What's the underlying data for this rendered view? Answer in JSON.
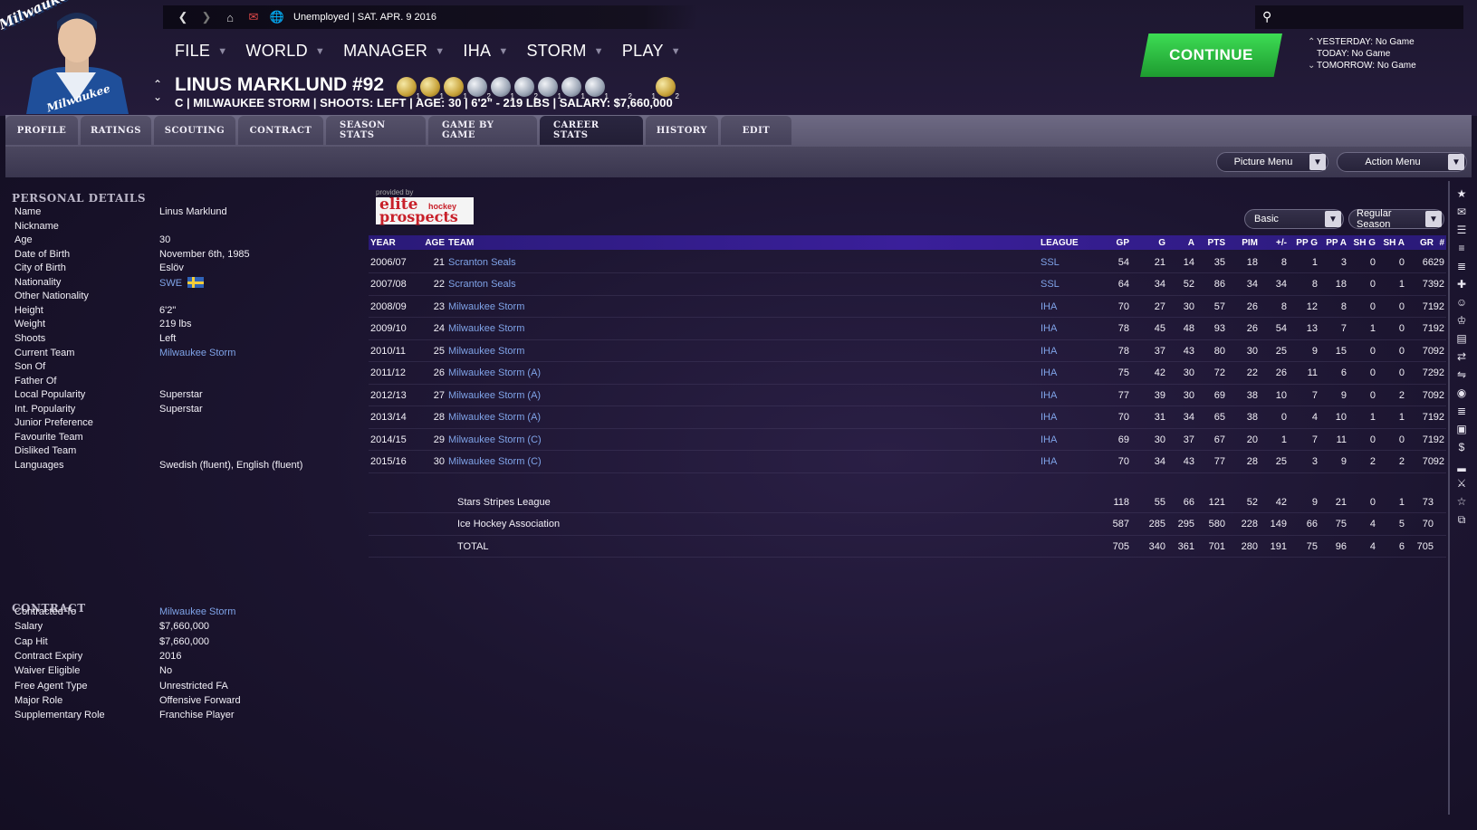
{
  "team_logo_text": "Milwaukee",
  "status": {
    "text": "Unemployed | SAT. APR. 9 2016"
  },
  "menu": [
    "FILE",
    "WORLD",
    "MANAGER",
    "IHA",
    "STORM",
    "PLAY"
  ],
  "player": {
    "name": "LINUS MARKLUND #92",
    "subline": "C | MILWAUKEE STORM | SHOOTS: LEFT | AGE: 30 | 6'2\" - 219 LBS | SALARY: $7,660,000",
    "awards": [
      {
        "kind": "gold",
        "n": "1"
      },
      {
        "kind": "gold",
        "n": "1"
      },
      {
        "kind": "gold",
        "n": "1"
      },
      {
        "kind": "silver",
        "n": "2"
      },
      {
        "kind": "silver",
        "n": "1"
      },
      {
        "kind": "silver",
        "n": "2"
      },
      {
        "kind": "silver",
        "n": "1"
      },
      {
        "kind": "silver",
        "n": "1"
      },
      {
        "kind": "silver",
        "n": "1"
      },
      {
        "kind": "blank",
        "n": "2"
      },
      {
        "kind": "blank",
        "n": "1"
      },
      {
        "kind": "gold",
        "n": "2"
      }
    ]
  },
  "continue_label": "CONTINUE",
  "schedule": {
    "yesterday": "YESTERDAY: No Game",
    "today": "TODAY: No Game",
    "tomorrow": "TOMORROW: No Game"
  },
  "tabs": [
    {
      "label": "PROFILE",
      "active": false
    },
    {
      "label": "RATINGS",
      "active": false
    },
    {
      "label": "SCOUTING",
      "active": false
    },
    {
      "label": "CONTRACT",
      "active": false
    },
    {
      "label": "SEASON STATS",
      "active": false
    },
    {
      "label": "GAME BY GAME",
      "active": false
    },
    {
      "label": "CAREER STATS",
      "active": true
    },
    {
      "label": "HISTORY",
      "active": false
    },
    {
      "label": "EDIT",
      "active": false
    }
  ],
  "picture_menu_label": "Picture Menu",
  "action_menu_label": "Action Menu",
  "personal_details": {
    "title": "PERSONAL DETAILS",
    "rows": [
      {
        "label": "Name",
        "value": "Linus Marklund"
      },
      {
        "label": "Nickname",
        "value": ""
      },
      {
        "label": "Age",
        "value": "30"
      },
      {
        "label": "Date of Birth",
        "value": "November 6th, 1985"
      },
      {
        "label": "City of Birth",
        "value": "Eslöv"
      },
      {
        "label": "Nationality",
        "value": "SWE",
        "link": true,
        "flag": true
      },
      {
        "label": "Other Nationality",
        "value": ""
      },
      {
        "label": "Height",
        "value": "6'2\""
      },
      {
        "label": "Weight",
        "value": "219 lbs"
      },
      {
        "label": "Shoots",
        "value": "Left"
      },
      {
        "label": "Current Team",
        "value": "Milwaukee Storm",
        "link": true
      },
      {
        "label": "Son Of",
        "value": ""
      },
      {
        "label": "Father Of",
        "value": ""
      },
      {
        "label": "Local Popularity",
        "value": "Superstar"
      },
      {
        "label": "Int. Popularity",
        "value": "Superstar"
      },
      {
        "label": "Junior Preference",
        "value": ""
      },
      {
        "label": "Favourite Team",
        "value": ""
      },
      {
        "label": "Disliked Team",
        "value": ""
      },
      {
        "label": "Languages",
        "value": "Swedish (fluent), English (fluent)"
      }
    ]
  },
  "contract": {
    "title": "CONTRACT",
    "rows": [
      {
        "label": "Contracted To",
        "value": "Milwaukee Storm",
        "link": true
      },
      {
        "label": "Salary",
        "value": "$7,660,000"
      },
      {
        "label": "Cap Hit",
        "value": "$7,660,000"
      },
      {
        "label": "Contract Expiry",
        "value": "2016"
      },
      {
        "label": "Waiver Eligible",
        "value": "No"
      },
      {
        "label": "Free Agent Type",
        "value": "Unrestricted FA"
      },
      {
        "label": "Major Role",
        "value": "Offensive Forward"
      },
      {
        "label": "Supplementary Role",
        "value": "Franchise Player"
      }
    ]
  },
  "elite": {
    "provided": "provided by",
    "line1": "elite",
    "small": "hockey",
    "line2": "prospects"
  },
  "filters": {
    "view": "Basic",
    "season": "Regular Season"
  },
  "table": {
    "headers": [
      "YEAR",
      "AGE",
      "TEAM",
      "LEAGUE",
      "GP",
      "G",
      "A",
      "PTS",
      "PIM",
      "+/-",
      "PP G",
      "PP A",
      "SH G",
      "SH A",
      "GR",
      "#"
    ],
    "rows": [
      [
        "2006/07",
        "21",
        "Scranton Seals",
        "SSL",
        "54",
        "21",
        "14",
        "35",
        "18",
        "8",
        "1",
        "3",
        "0",
        "0",
        "66",
        "29"
      ],
      [
        "2007/08",
        "22",
        "Scranton Seals",
        "SSL",
        "64",
        "34",
        "52",
        "86",
        "34",
        "34",
        "8",
        "18",
        "0",
        "1",
        "73",
        "92"
      ],
      [
        "2008/09",
        "23",
        "Milwaukee Storm",
        "IHA",
        "70",
        "27",
        "30",
        "57",
        "26",
        "8",
        "12",
        "8",
        "0",
        "0",
        "71",
        "92"
      ],
      [
        "2009/10",
        "24",
        "Milwaukee Storm",
        "IHA",
        "78",
        "45",
        "48",
        "93",
        "26",
        "54",
        "13",
        "7",
        "1",
        "0",
        "71",
        "92"
      ],
      [
        "2010/11",
        "25",
        "Milwaukee Storm",
        "IHA",
        "78",
        "37",
        "43",
        "80",
        "30",
        "25",
        "9",
        "15",
        "0",
        "0",
        "70",
        "92"
      ],
      [
        "2011/12",
        "26",
        "Milwaukee Storm (A)",
        "IHA",
        "75",
        "42",
        "30",
        "72",
        "22",
        "26",
        "11",
        "6",
        "0",
        "0",
        "72",
        "92"
      ],
      [
        "2012/13",
        "27",
        "Milwaukee Storm (A)",
        "IHA",
        "77",
        "39",
        "30",
        "69",
        "38",
        "10",
        "7",
        "9",
        "0",
        "2",
        "70",
        "92"
      ],
      [
        "2013/14",
        "28",
        "Milwaukee Storm (A)",
        "IHA",
        "70",
        "31",
        "34",
        "65",
        "38",
        "0",
        "4",
        "10",
        "1",
        "1",
        "71",
        "92"
      ],
      [
        "2014/15",
        "29",
        "Milwaukee Storm (C)",
        "IHA",
        "69",
        "30",
        "37",
        "67",
        "20",
        "1",
        "7",
        "11",
        "0",
        "0",
        "71",
        "92"
      ],
      [
        "2015/16",
        "30",
        "Milwaukee Storm (C)",
        "IHA",
        "70",
        "34",
        "43",
        "77",
        "28",
        "25",
        "3",
        "9",
        "2",
        "2",
        "70",
        "92"
      ]
    ],
    "totals": [
      [
        "Stars Stripes League",
        "118",
        "55",
        "66",
        "121",
        "52",
        "42",
        "9",
        "21",
        "0",
        "1",
        "73",
        ""
      ],
      [
        "Ice Hockey Association",
        "587",
        "285",
        "295",
        "580",
        "228",
        "149",
        "66",
        "75",
        "4",
        "5",
        "70",
        ""
      ],
      [
        "TOTAL",
        "705",
        "340",
        "361",
        "701",
        "280",
        "191",
        "75",
        "96",
        "4",
        "6",
        "705",
        ""
      ]
    ]
  },
  "right_icons": [
    "team-logo-icon",
    "mail-icon",
    "roster-icon",
    "lines-icon",
    "list-icon",
    "injury-icon",
    "players-icon",
    "trophy-icon",
    "notes-icon",
    "transactions-icon",
    "trade-icon",
    "team-badge-icon",
    "list-icon-2",
    "scouting-icon",
    "finance-icon",
    "stats-icon",
    "tools-icon",
    "awards-icon",
    "history-icon"
  ],
  "colors": {
    "accent_green": "#2ec043",
    "link_blue": "#7fa3e8",
    "header_purple": "#3a1f9a"
  }
}
